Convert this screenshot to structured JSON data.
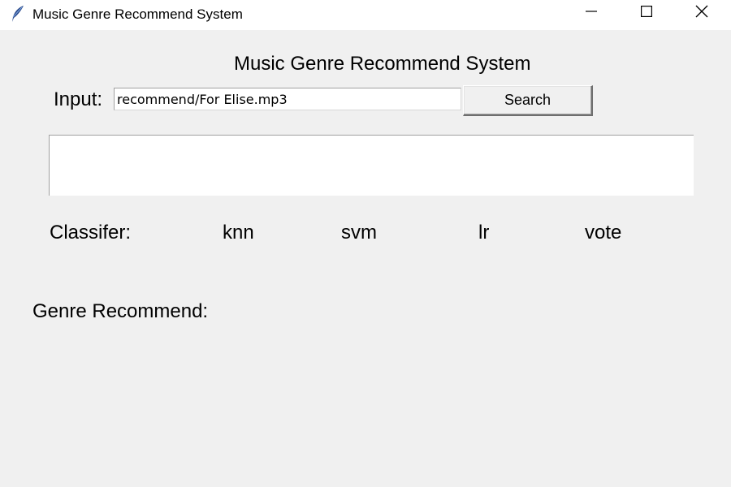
{
  "window": {
    "title": "Music Genre Recommend System",
    "icon": "feather-icon",
    "controls": [
      "minimize-icon",
      "maximize-icon",
      "close-icon"
    ]
  },
  "header": {
    "title": "Music Genre Recommend System"
  },
  "input": {
    "label": "Input:",
    "value": "recommend/For Elise.mp3",
    "placeholder": ""
  },
  "search": {
    "label": "Search"
  },
  "result": {
    "text": ""
  },
  "classifier": {
    "label": "Classifer:",
    "options": [
      "knn",
      "svm",
      "lr",
      "vote"
    ]
  },
  "genre": {
    "label": "Genre Recommend:"
  }
}
